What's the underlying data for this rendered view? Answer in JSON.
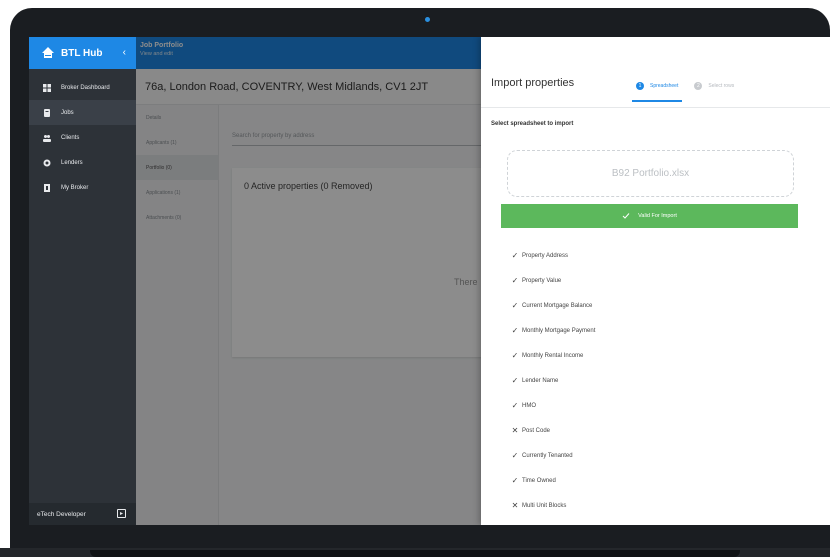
{
  "app": {
    "brand": "BTL Hub",
    "collapse_glyph": "‹",
    "accent_color": "#1e88e5",
    "success_color": "#5cb85c"
  },
  "sidebar": {
    "items": [
      {
        "label": "Broker Dashboard",
        "icon": "dashboard-icon",
        "active": false
      },
      {
        "label": "Jobs",
        "icon": "jobs-icon",
        "active": true
      },
      {
        "label": "Clients",
        "icon": "clients-icon",
        "active": false
      },
      {
        "label": "Lenders",
        "icon": "lenders-icon",
        "active": false
      },
      {
        "label": "My Broker",
        "icon": "my-broker-icon",
        "active": false
      }
    ],
    "footer_user": "eTech Developer",
    "footer_button_glyph": "▸"
  },
  "header": {
    "title": "Job Portfolio",
    "subtitle": "View and edit",
    "more_glyph": "⋮"
  },
  "job": {
    "address": "76a, London Road, COVENTRY, West Midlands, CV1 2JT",
    "tabs": [
      {
        "label": "Details",
        "active": false
      },
      {
        "label": "Applicants (1)",
        "active": false
      },
      {
        "label": "Portfolio (0)",
        "active": true
      },
      {
        "label": "Applications (1)",
        "active": false
      },
      {
        "label": "Attachments (0)",
        "active": false
      }
    ],
    "search_placeholder": "Search for property by address",
    "properties_summary": "0 Active properties (0 Removed)",
    "empty_text_partial": "There"
  },
  "import_panel": {
    "title": "Import properties",
    "steps": [
      {
        "number": "1",
        "label": "Spreadsheet",
        "active": true
      },
      {
        "number": "2",
        "label": "Select rows",
        "active": false
      }
    ],
    "section_title": "Select spreadsheet to import",
    "file_name": "B92 Portfolio.xlsx",
    "status": "Valid For Import",
    "fields": [
      {
        "label": "Property Address",
        "mapped": true,
        "mark": "✓"
      },
      {
        "label": "Property Value",
        "mapped": true,
        "mark": "✓"
      },
      {
        "label": "Current Mortgage Balance",
        "mapped": true,
        "mark": "✓"
      },
      {
        "label": "Monthly Mortgage Payment",
        "mapped": true,
        "mark": "✓"
      },
      {
        "label": "Monthly Rental Income",
        "mapped": true,
        "mark": "✓"
      },
      {
        "label": "Lender Name",
        "mapped": true,
        "mark": "✓"
      },
      {
        "label": "HMO",
        "mapped": true,
        "mark": "✓"
      },
      {
        "label": "Post Code",
        "mapped": false,
        "mark": "✕"
      },
      {
        "label": "Currently Tenanted",
        "mapped": true,
        "mark": "✓"
      },
      {
        "label": "Time Owned",
        "mapped": true,
        "mark": "✓"
      },
      {
        "label": "Multi Unit Blocks",
        "mapped": false,
        "mark": "✕"
      }
    ]
  }
}
